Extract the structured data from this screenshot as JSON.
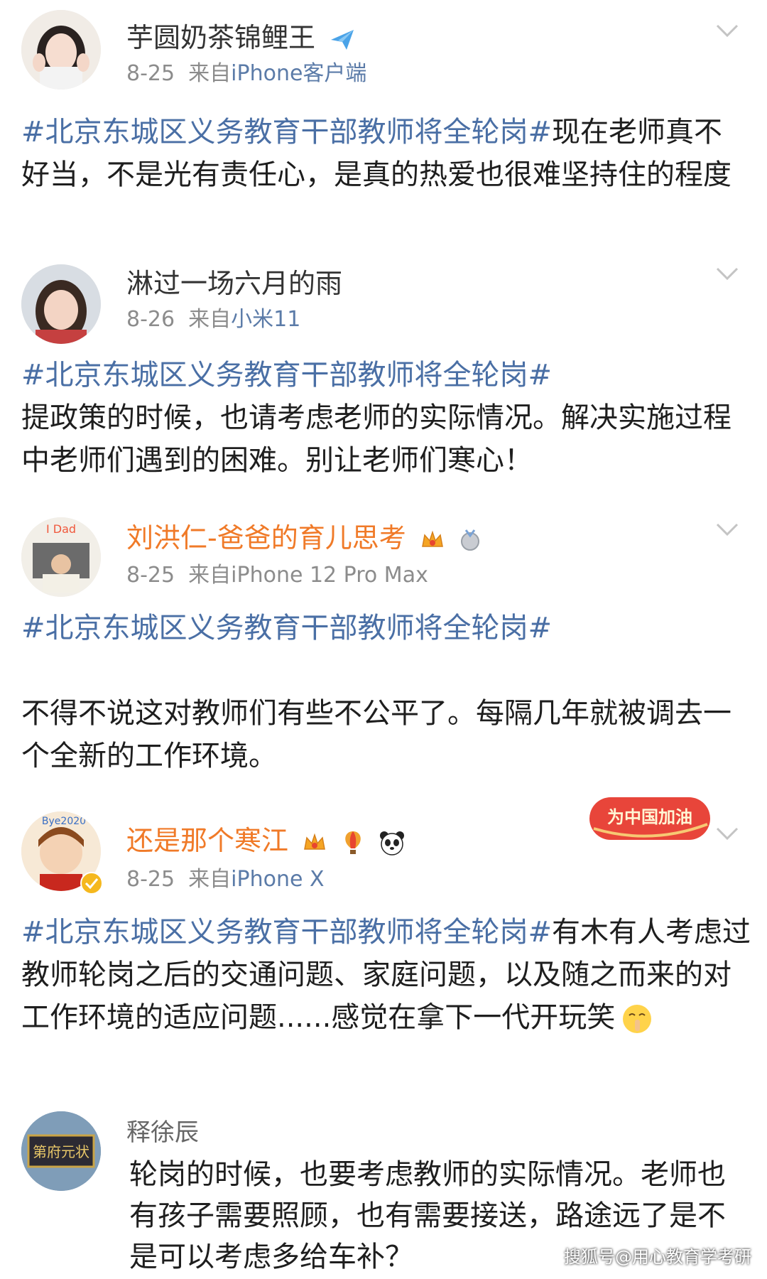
{
  "posts": [
    {
      "name": "芋圆奶茶锦鲤王",
      "date": "8-25",
      "via": "来自",
      "source": "iPhone客户端",
      "hashtag": "#北京东城区义务教育干部教师将全轮岗#",
      "text": "现在老师真不好当，不是光有责任心，是真的热爱也很难坚持住的程度"
    },
    {
      "name": "淋过一场六月的雨",
      "date": "8-26",
      "via": "来自",
      "source": "小米11",
      "hashtag": "#北京东城区义务教育干部教师将全轮岗#",
      "text": "提政策的时候，也请考虑老师的实际情况。解决实施过程中老师们遇到的困难。别让老师们寒心！"
    },
    {
      "name": "刘洪仁-爸爸的育儿思考",
      "date": "8-25",
      "via": "来自",
      "source": "iPhone 12 Pro Max",
      "hashtag": "#北京东城区义务教育干部教师将全轮岗#",
      "text": "不得不说这对教师们有些不公平了。每隔几年就被调去一个全新的工作环境。",
      "avatar_text": "I Dad"
    },
    {
      "name": "还是那个寒江",
      "date": "8-25",
      "via": "来自",
      "source": "iPhone X",
      "hashtag": "#北京东城区义务教育干部教师将全轮岗#",
      "text": "有木有人考虑过教师轮岗之后的交通问题、家庭问题，以及随之而来的对工作环境的适应问题......感觉在拿下一代开玩笑",
      "avatar_text": "Bye2020",
      "banner": "为中国加油"
    }
  ],
  "comment": {
    "name": "释徐辰",
    "text": "轮岗的时候，也要考虑教师的实际情况。老师也有孩子需要照顾，也有需要接送，路途远了是不是可以考虑多给车补？",
    "avatar_text": "第府元状"
  },
  "watermark": "搜狐号@用心教育学考研",
  "colors": {
    "hashtag": "#4a6fa5",
    "vip_name": "#f07a28",
    "meta": "#8c8c8c"
  }
}
